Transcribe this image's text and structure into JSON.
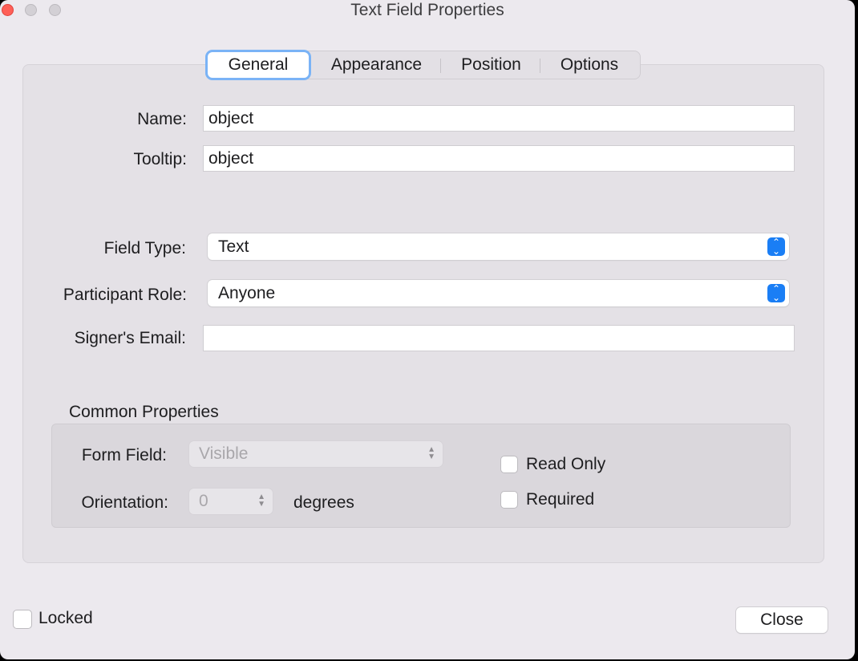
{
  "window": {
    "title": "Text Field Properties"
  },
  "tabs": [
    "General",
    "Appearance",
    "Position",
    "Options"
  ],
  "general": {
    "name_label": "Name:",
    "name_value": "object",
    "tooltip_label": "Tooltip:",
    "tooltip_value": "object",
    "field_type_label": "Field Type:",
    "field_type_value": "Text",
    "participant_role_label": "Participant Role:",
    "participant_role_value": "Anyone",
    "signer_email_label": "Signer's Email:",
    "signer_email_value": ""
  },
  "common": {
    "title": "Common Properties",
    "form_field_label": "Form Field:",
    "form_field_value": "Visible",
    "orientation_label": "Orientation:",
    "orientation_value": "0",
    "degrees_label": "degrees",
    "read_only_label": "Read Only",
    "read_only_checked": false,
    "required_label": "Required",
    "required_checked": false
  },
  "footer": {
    "locked_label": "Locked",
    "locked_checked": false,
    "close_label": "Close"
  }
}
